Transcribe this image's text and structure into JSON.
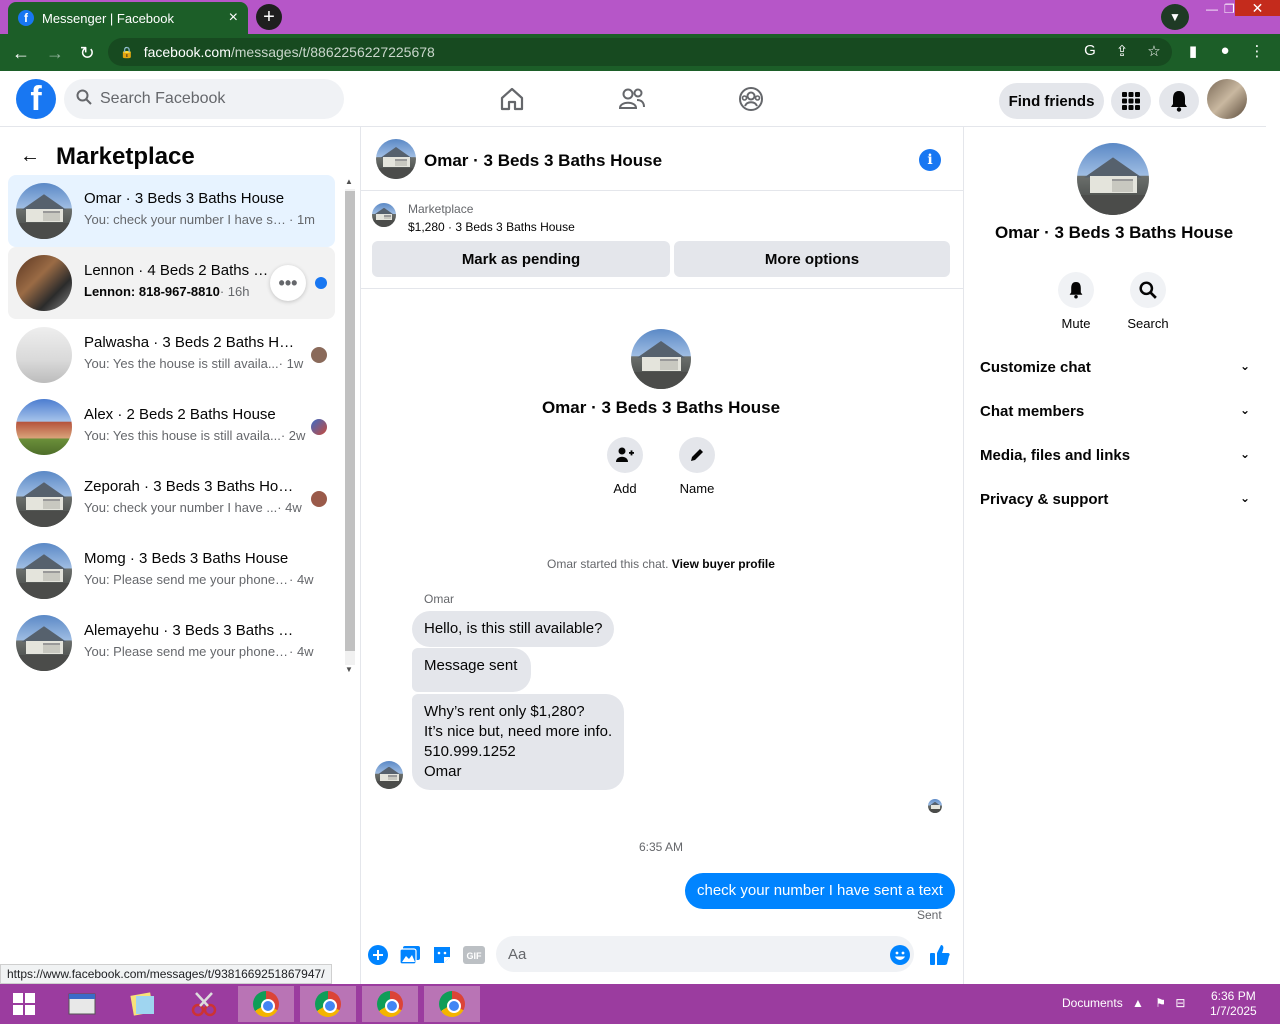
{
  "browser": {
    "tab_title": "Messenger | Facebook",
    "url_host": "facebook.com",
    "url_path": "/messages/t/8862256227225678",
    "status_url": "https://www.facebook.com/messages/t/9381669251867947/"
  },
  "header": {
    "search_placeholder": "Search Facebook",
    "find_friends": "Find friends"
  },
  "left": {
    "title": "Marketplace",
    "conversations": [
      {
        "name": "Omar · 3 Beds 3 Baths House",
        "preview": "You: check your number I have se...",
        "time": "· 1m",
        "thumb": "house"
      },
      {
        "name": "Lennon · 4 Beds 2 Baths House",
        "preview": "Lennon: 818-967-8810",
        "time": "· 16h",
        "thumb": "kitchen"
      },
      {
        "name": "Palwasha · 3 Beds 2 Baths Ho...",
        "preview": "You: Yes the house is still availa...",
        "time": "· 1w",
        "thumb": "interior"
      },
      {
        "name": "Alex · 2 Beds 2 Baths House",
        "preview": "You: Yes this house is still availa...",
        "time": "· 2w",
        "thumb": "redhouse"
      },
      {
        "name": "Zeporah · 3 Beds 3 Baths Hou...",
        "preview": "You: check your number I have ...",
        "time": "· 4w",
        "thumb": "house"
      },
      {
        "name": "Momg · 3 Beds 3 Baths House",
        "preview": "You: Please send me your phone n...",
        "time": "· 4w",
        "thumb": "house"
      },
      {
        "name": "Alemayehu · 3 Beds 3 Baths Ho...",
        "preview": "You: Please send me your phone n...",
        "time": "· 4w",
        "thumb": "house"
      }
    ]
  },
  "chat": {
    "title": "Omar · 3 Beds 3 Baths House",
    "listing_category": "Marketplace",
    "listing_price": "$1,280 · 3 Beds 3 Baths House",
    "mark_pending": "Mark as pending",
    "more_options": "More options",
    "intro_name": "Omar · 3 Beds 3 Baths House",
    "add_label": "Add",
    "name_label": "Name",
    "started_text": "Omar started this chat.",
    "view_profile": "View buyer profile",
    "sender": "Omar",
    "msg1": "Hello, is this still available?",
    "msg2": "Message sent",
    "msg3_l1": "Why’s rent only $1,280?",
    "msg3_l2": "It’s nice but, need more info.",
    "msg3_l3": "510.999.1252",
    "msg3_l4": "Omar",
    "time": "6:35 AM",
    "my_msg": "check your number I have sent a text",
    "sent": "Sent",
    "input_placeholder": "Aa"
  },
  "right": {
    "name": "Omar · 3 Beds 3 Baths House",
    "mute": "Mute",
    "search": "Search",
    "items": [
      "Customize chat",
      "Chat members",
      "Media, files and links",
      "Privacy & support"
    ]
  },
  "taskbar": {
    "tray_label": "Documents",
    "time": "6:36 PM",
    "date": "1/7/2025"
  },
  "colors": {
    "accent": "#1877f2",
    "bubble_me": "#0084ff",
    "chrome_frame": "#1c5e28",
    "tabstrip": "#b656c8",
    "taskbar": "#9b3c9f"
  }
}
